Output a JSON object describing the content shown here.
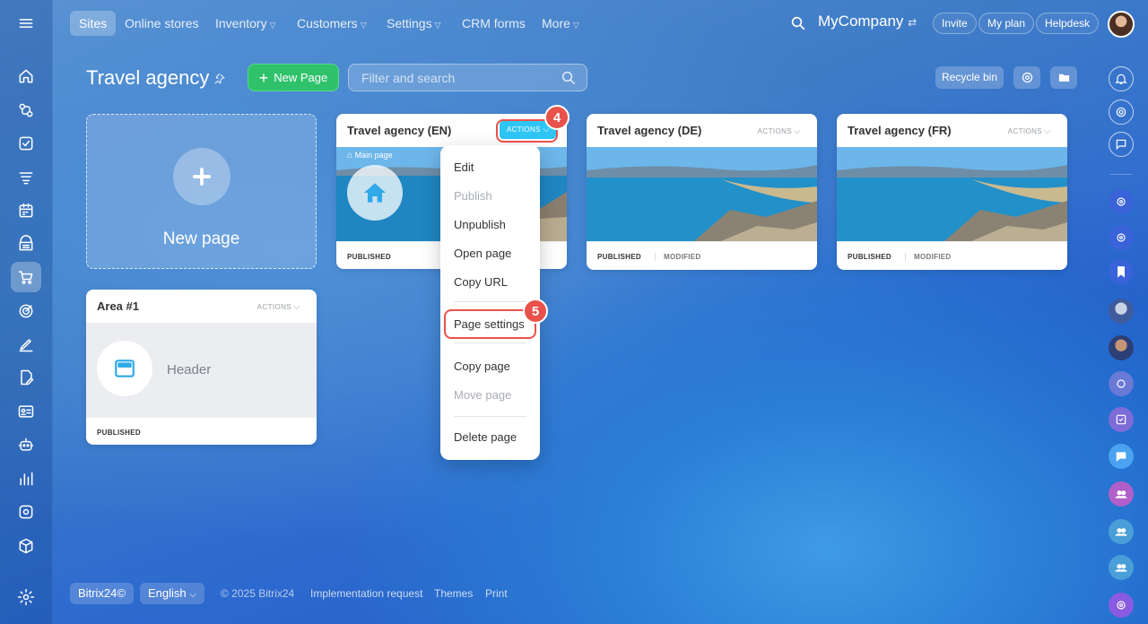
{
  "topnav": {
    "tabs": [
      {
        "label": "Sites",
        "active": true,
        "dropdown": false
      },
      {
        "label": "Online stores",
        "active": false,
        "dropdown": false
      },
      {
        "label": "Inventory",
        "active": false,
        "dropdown": true
      },
      {
        "label": "Customers",
        "active": false,
        "dropdown": true
      },
      {
        "label": "Settings",
        "active": false,
        "dropdown": true
      },
      {
        "label": "CRM forms",
        "active": false,
        "dropdown": false
      },
      {
        "label": "More",
        "active": false,
        "dropdown": true
      }
    ],
    "company": "MyCompany",
    "invite": "Invite",
    "plan": "My plan",
    "helpdesk": "Helpdesk"
  },
  "page": {
    "title": "Travel agency",
    "new_page_button": "New Page",
    "search_placeholder": "Filter and search",
    "recycle_bin": "Recycle bin"
  },
  "new_page_card": {
    "label": "New page"
  },
  "cards": [
    {
      "title": "Travel agency (EN)",
      "actions": "ACTIONS",
      "main_label": "Main page",
      "status": "PUBLISHED",
      "modified": ""
    },
    {
      "title": "Travel agency (DE)",
      "actions": "ACTIONS",
      "status": "PUBLISHED",
      "modified": "MODIFIED"
    },
    {
      "title": "Travel agency (FR)",
      "actions": "ACTIONS",
      "status": "PUBLISHED",
      "modified": "MODIFIED"
    },
    {
      "title": "Area #1",
      "actions": "ACTIONS",
      "area_label": "Header",
      "status": "PUBLISHED"
    }
  ],
  "menu": {
    "items": [
      {
        "label": "Edit",
        "disabled": false
      },
      {
        "label": "Publish",
        "disabled": true
      },
      {
        "label": "Unpublish",
        "disabled": false
      },
      {
        "label": "Open page",
        "disabled": false
      },
      {
        "label": "Copy URL",
        "disabled": false
      },
      {
        "label": "Page settings",
        "disabled": false
      },
      {
        "label": "Copy page",
        "disabled": false
      },
      {
        "label": "Move page",
        "disabled": true
      },
      {
        "label": "Delete page",
        "disabled": false
      }
    ]
  },
  "callouts": {
    "actions_step": "4",
    "settings_step": "5"
  },
  "footer": {
    "brand": "Bitrix24©",
    "language": "English",
    "copyright": "© 2025 Bitrix24",
    "implementation": "Implementation request",
    "themes": "Themes",
    "print": "Print"
  },
  "colors": {
    "accent_green": "#2fc26b",
    "callout_red": "#e8524a",
    "actions_blue": "#2fc6f6"
  },
  "icons": {
    "left_sidebar": [
      "menu-icon",
      "home-icon",
      "crm-icon",
      "tasks-icon",
      "feed-icon",
      "calendar-icon",
      "store-icon",
      "cart-icon",
      "target-icon",
      "pen-icon",
      "doc-edit-icon",
      "id-card-icon",
      "robot-icon",
      "chart-icon",
      "settings-box-icon",
      "cube-icon",
      "gear-icon"
    ],
    "right_sidebar": [
      "bell-icon",
      "copilot-icon",
      "chat-icon",
      "copilot-icon",
      "copilot-icon",
      "bookmark-icon",
      "user-avatar",
      "user-avatar",
      "group-avatar",
      "task-icon",
      "chat-bubble-icon",
      "group-icon",
      "group-icon",
      "group-icon",
      "copilot-icon"
    ]
  }
}
